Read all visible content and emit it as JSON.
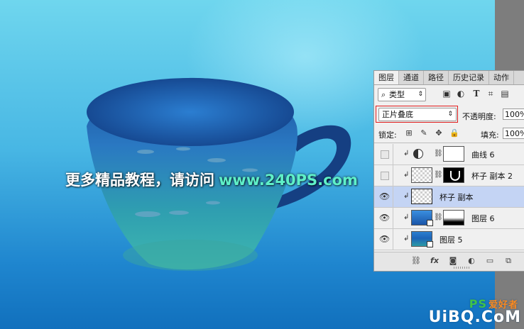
{
  "canvas": {
    "headline_text": "更多精品教程，请访问",
    "headline_url": "www.240PS.com",
    "watermark": {
      "brand": "UiBQ.CoM",
      "ps_text": "PS",
      "hanzi": "爱好者",
      "site": ""
    }
  },
  "layers_panel": {
    "tabs": [
      {
        "label": "图层",
        "active": true
      },
      {
        "label": "通道",
        "active": false
      },
      {
        "label": "路径",
        "active": false
      },
      {
        "label": "历史记录",
        "active": false
      },
      {
        "label": "动作",
        "active": false
      }
    ],
    "filter": {
      "kind_label": "类型",
      "icons": [
        "image-filter-icon",
        "adjustment-filter-icon",
        "type-filter-icon",
        "shape-filter-icon",
        "smart-object-filter-icon"
      ]
    },
    "blend_mode": "正片叠底",
    "opacity_label": "不透明度:",
    "opacity_value": "100%",
    "lock_label": "锁定:",
    "fill_label": "填充:",
    "fill_value": "100%",
    "layers": [
      {
        "name": "曲线 6",
        "visible": false,
        "selected": false,
        "type": "adjustment"
      },
      {
        "name": "杯子 副本 2",
        "visible": false,
        "selected": false,
        "type": "masked"
      },
      {
        "name": "杯子 副本",
        "visible": true,
        "selected": true,
        "type": "plain"
      },
      {
        "name": "图层 6",
        "visible": true,
        "selected": false,
        "type": "smart-masked"
      },
      {
        "name": "图层 5",
        "visible": true,
        "selected": false,
        "type": "smart"
      }
    ],
    "bottom_icons": [
      "link-layers-icon",
      "fx-icon",
      "add-mask-icon",
      "new-adjustment-icon",
      "new-group-icon",
      "new-layer-icon"
    ],
    "fx_label": "fx"
  },
  "colors": {
    "selected_layer": "#c4d4f4",
    "highlight_box": "#e01c1c",
    "url_text": "#5ff0c8"
  }
}
